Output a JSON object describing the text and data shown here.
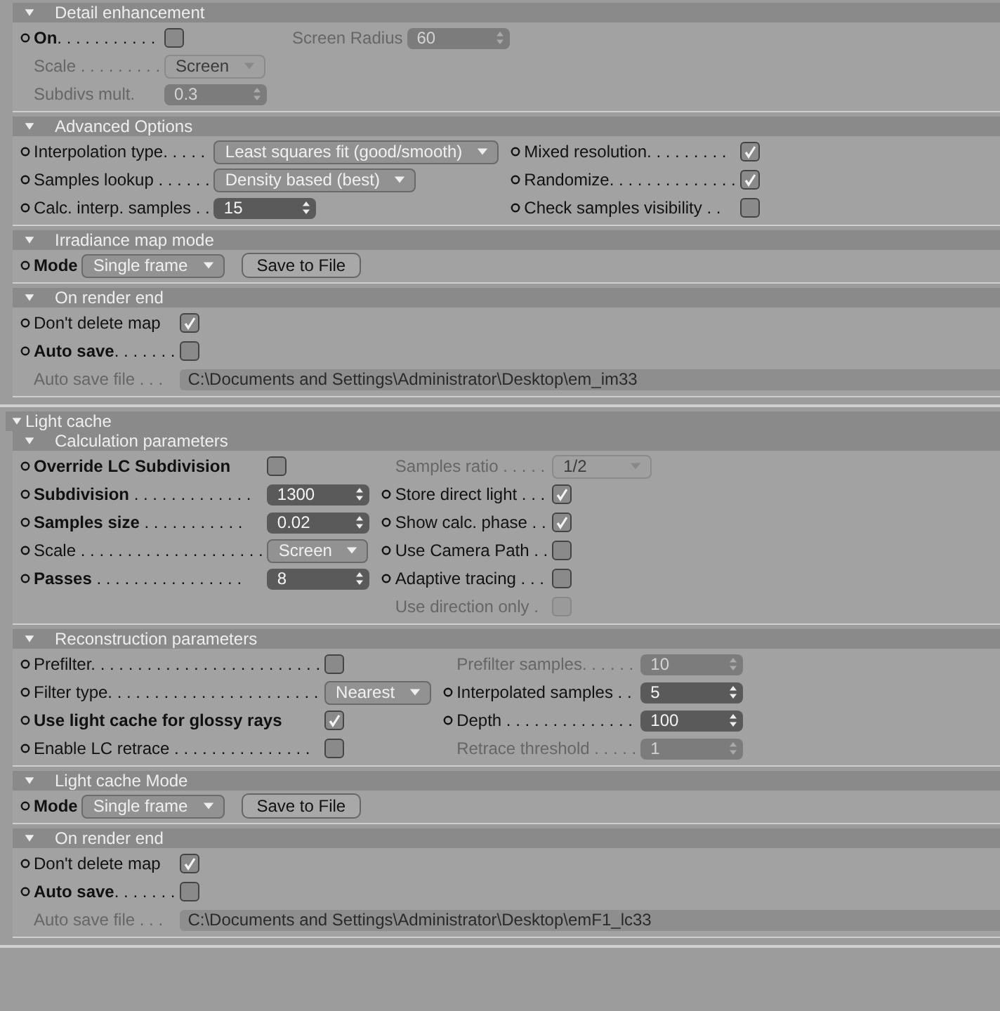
{
  "groups": [
    {
      "sections": [
        {
          "title": "Detail enhancement",
          "expanded": true,
          "columns": [
            [
              {
                "label": "**On**. . . . . . . . . . .",
                "dot": true,
                "disabled": false,
                "kind": "checkbox",
                "checked": false
              },
              {
                "label": "Scale . . . . . . . . .",
                "dot": false,
                "disabled": true,
                "kind": "dropdown",
                "value": "Screen"
              },
              {
                "label": "Subdivs mult.",
                "dot": false,
                "disabled": true,
                "kind": "number",
                "value": "0.3"
              }
            ],
            [
              {
                "label": "Screen Radius",
                "dot": false,
                "disabled": true,
                "kind": "number",
                "value": "60"
              }
            ]
          ]
        },
        {
          "title": "Advanced Options",
          "expanded": true,
          "columns": [
            [
              {
                "label": "Interpolation type. . . . .",
                "dot": true,
                "disabled": false,
                "kind": "dropdown",
                "value": "Least squares fit (good/smooth)"
              },
              {
                "label": "Samples lookup . . . . . .",
                "dot": true,
                "disabled": false,
                "kind": "dropdown",
                "value": "Density based (best)"
              },
              {
                "label": "Calc. interp. samples . .",
                "dot": true,
                "disabled": false,
                "kind": "number",
                "value": "15"
              }
            ],
            [
              {
                "label": "Mixed resolution. . . . . . . . .",
                "dot": true,
                "disabled": false,
                "kind": "checkbox",
                "checked": true
              },
              {
                "label": "Randomize. . . . . . . . . . . . . .",
                "dot": true,
                "disabled": false,
                "kind": "checkbox",
                "checked": true
              },
              {
                "label": "Check samples visibility . .",
                "dot": true,
                "disabled": false,
                "kind": "checkbox",
                "checked": false
              }
            ]
          ]
        },
        {
          "title": "Irradiance map mode",
          "expanded": true,
          "columns": [
            [
              {
                "label": "**Mode**",
                "dot": true,
                "disabled": false,
                "kind": "dropdown",
                "value": "Single frame",
                "button": "Save to File"
              }
            ]
          ]
        },
        {
          "title": "On render end",
          "expanded": true,
          "columns": [
            [
              {
                "label": "Don't delete map",
                "dot": true,
                "disabled": false,
                "kind": "checkbox",
                "checked": true
              },
              {
                "label": "**Auto save**. . . . . . .",
                "dot": true,
                "disabled": false,
                "kind": "checkbox",
                "checked": false
              },
              {
                "label": "Auto save file . . .",
                "dot": false,
                "disabled": true,
                "kind": "path",
                "value": "C:\\Documents and Settings\\Administrator\\Desktop\\em_im33"
              }
            ]
          ]
        }
      ]
    },
    {
      "title": "Light cache",
      "expanded": true,
      "sections": [
        {
          "title": "Calculation parameters",
          "expanded": true,
          "columns": [
            [
              {
                "label": "**Override LC Subdivision**",
                "dot": true,
                "disabled": false,
                "kind": "checkbox",
                "checked": false
              },
              {
                "label": "**Subdivision** . . . . . . . . . . . . .",
                "dot": true,
                "disabled": false,
                "kind": "number",
                "value": "1300"
              },
              {
                "label": "**Samples size** . . . . . . . . . . .",
                "dot": true,
                "disabled": false,
                "kind": "number",
                "value": "0.02"
              },
              {
                "label": "Scale . . . . . . . . . . . . . . . . . . . .",
                "dot": true,
                "disabled": false,
                "kind": "dropdown",
                "value": "Screen"
              },
              {
                "label": "**Passes** . . . . . . . . . . . . . . . .",
                "dot": true,
                "disabled": false,
                "kind": "number",
                "value": "8"
              }
            ],
            [
              {
                "label": "Samples ratio . . . . .",
                "dot": false,
                "disabled": true,
                "kind": "dropdown",
                "value": "1/2"
              },
              {
                "label": "Store direct light . . .",
                "dot": true,
                "disabled": false,
                "kind": "checkbox",
                "checked": true
              },
              {
                "label": "Show calc. phase . .",
                "dot": true,
                "disabled": false,
                "kind": "checkbox",
                "checked": true
              },
              {
                "label": "Use Camera Path . .",
                "dot": true,
                "disabled": false,
                "kind": "checkbox",
                "checked": false
              },
              {
                "label": "Adaptive tracing . . .",
                "dot": true,
                "disabled": false,
                "kind": "checkbox",
                "checked": false
              },
              {
                "label": "Use direction only .",
                "dot": false,
                "disabled": true,
                "kind": "checkbox",
                "checked": false
              }
            ]
          ]
        },
        {
          "title": "Reconstruction parameters",
          "expanded": true,
          "columns": [
            [
              {
                "label": "Prefilter. . . . . . . . . . . . . . . . . . . . . . . . .",
                "dot": true,
                "disabled": false,
                "kind": "checkbox",
                "checked": false
              },
              {
                "label": "Filter type. . . . . . . . . . . . . . . . . . . . . . .",
                "dot": true,
                "disabled": false,
                "kind": "dropdown",
                "value": "Nearest"
              },
              {
                "label": "**Use light cache for glossy rays**",
                "dot": true,
                "disabled": false,
                "kind": "checkbox",
                "checked": true
              },
              {
                "label": "Enable LC retrace . . . . . . . . . . . . . . .",
                "dot": true,
                "disabled": false,
                "kind": "checkbox",
                "checked": false
              }
            ],
            [
              {
                "label": "Prefilter samples. . . . . .",
                "dot": false,
                "disabled": true,
                "kind": "number",
                "value": "10"
              },
              {
                "label": "Interpolated samples . .",
                "dot": true,
                "disabled": false,
                "kind": "number",
                "value": "5"
              },
              {
                "label": "Depth . . . . . . . . . . . . . .",
                "dot": true,
                "disabled": false,
                "kind": "number",
                "value": "100"
              },
              {
                "label": "Retrace threshold . . . . .",
                "dot": false,
                "disabled": true,
                "kind": "number",
                "value": "1"
              }
            ]
          ]
        },
        {
          "title": "Light cache Mode",
          "expanded": true,
          "columns": [
            [
              {
                "label": "**Mode**",
                "dot": true,
                "disabled": false,
                "kind": "dropdown",
                "value": "Single frame",
                "button": "Save to File"
              }
            ]
          ]
        },
        {
          "title": "On render end",
          "expanded": true,
          "columns": [
            [
              {
                "label": "Don't delete map",
                "dot": true,
                "disabled": false,
                "kind": "checkbox",
                "checked": true
              },
              {
                "label": "**Auto save**. . . . . . .",
                "dot": true,
                "disabled": false,
                "kind": "checkbox",
                "checked": false
              },
              {
                "label": "Auto save file . . .",
                "dot": false,
                "disabled": true,
                "kind": "path",
                "value": "C:\\Documents and Settings\\Administrator\\Desktop\\emF1_lc33"
              }
            ]
          ]
        }
      ]
    }
  ]
}
